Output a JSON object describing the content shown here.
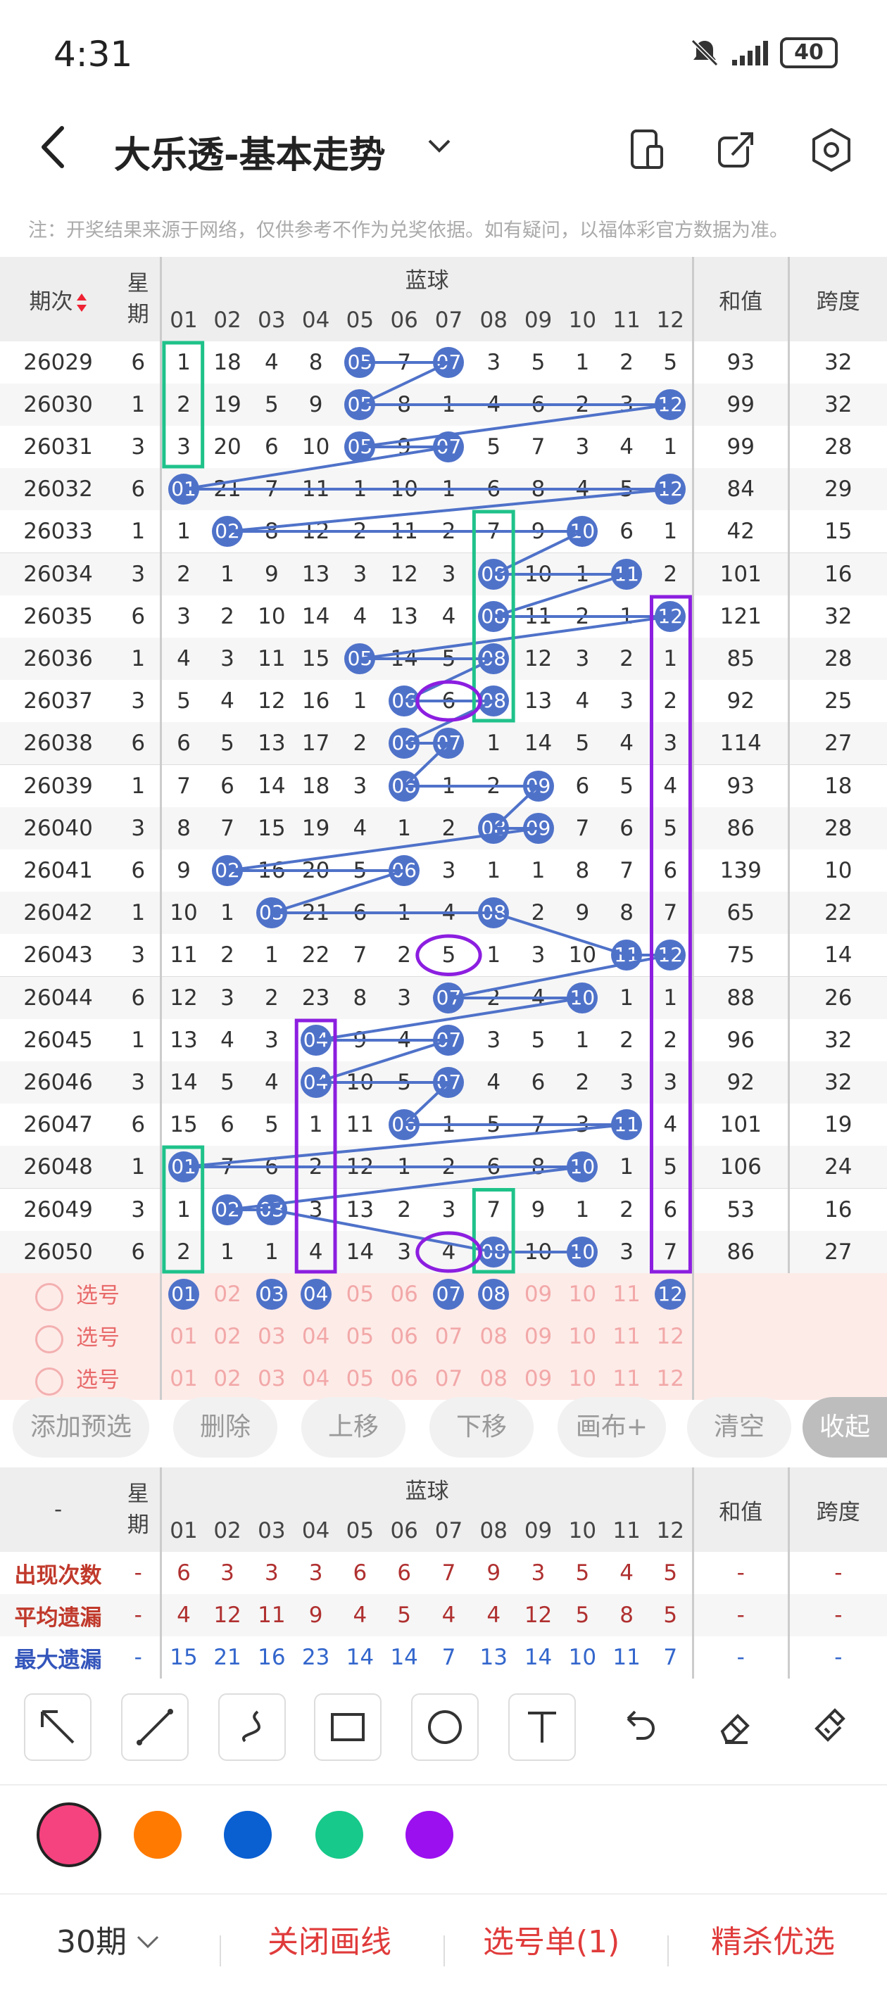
{
  "status": {
    "time": "4:31",
    "battery": "40"
  },
  "header": {
    "title": "大乐透-基本走势"
  },
  "note": "注：开奖结果来源于网络，仅供参考不作为兑奖依据。如有疑问，以福体彩官方数据为准。",
  "table": {
    "col_issue": "期次",
    "col_week": "星期",
    "group_label": "蓝球",
    "nums": [
      "01",
      "02",
      "03",
      "04",
      "05",
      "06",
      "07",
      "08",
      "09",
      "10",
      "11",
      "12"
    ],
    "col_sum": "和值",
    "col_span": "跨度",
    "rows": [
      {
        "issue": "26029",
        "week": "6",
        "cells": [
          "1",
          "18",
          "4",
          "8",
          "05",
          "7",
          "07",
          "3",
          "5",
          "1",
          "2",
          "5"
        ],
        "hit": [
          4,
          6
        ],
        "sum": "93",
        "span": "32"
      },
      {
        "issue": "26030",
        "week": "1",
        "cells": [
          "2",
          "19",
          "5",
          "9",
          "05",
          "8",
          "1",
          "4",
          "6",
          "2",
          "3",
          "12"
        ],
        "hit": [
          4,
          11
        ],
        "sum": "99",
        "span": "32"
      },
      {
        "issue": "26031",
        "week": "3",
        "cells": [
          "3",
          "20",
          "6",
          "10",
          "05",
          "9",
          "07",
          "5",
          "7",
          "3",
          "4",
          "1"
        ],
        "hit": [
          4,
          6
        ],
        "sum": "99",
        "span": "28"
      },
      {
        "issue": "26032",
        "week": "6",
        "cells": [
          "01",
          "21",
          "7",
          "11",
          "1",
          "10",
          "1",
          "6",
          "8",
          "4",
          "5",
          "12"
        ],
        "hit": [
          0,
          11
        ],
        "sum": "84",
        "span": "29"
      },
      {
        "issue": "26033",
        "week": "1",
        "cells": [
          "1",
          "02",
          "8",
          "12",
          "2",
          "11",
          "2",
          "7",
          "9",
          "10",
          "6",
          "1"
        ],
        "hit": [
          1,
          9
        ],
        "sum": "42",
        "span": "15"
      },
      {
        "issue": "26034",
        "week": "3",
        "cells": [
          "2",
          "1",
          "9",
          "13",
          "3",
          "12",
          "3",
          "08",
          "10",
          "1",
          "11",
          "2"
        ],
        "hit": [
          7,
          10
        ],
        "sum": "101",
        "span": "16"
      },
      {
        "issue": "26035",
        "week": "6",
        "cells": [
          "3",
          "2",
          "10",
          "14",
          "4",
          "13",
          "4",
          "08",
          "11",
          "2",
          "1",
          "12"
        ],
        "hit": [
          7,
          11
        ],
        "sum": "121",
        "span": "32"
      },
      {
        "issue": "26036",
        "week": "1",
        "cells": [
          "4",
          "3",
          "11",
          "15",
          "05",
          "14",
          "5",
          "08",
          "12",
          "3",
          "2",
          "1"
        ],
        "hit": [
          4,
          7
        ],
        "sum": "85",
        "span": "28"
      },
      {
        "issue": "26037",
        "week": "3",
        "cells": [
          "5",
          "4",
          "12",
          "16",
          "1",
          "06",
          "6",
          "08",
          "13",
          "4",
          "3",
          "2"
        ],
        "hit": [
          5,
          7
        ],
        "sum": "92",
        "span": "25"
      },
      {
        "issue": "26038",
        "week": "6",
        "cells": [
          "6",
          "5",
          "13",
          "17",
          "2",
          "06",
          "07",
          "1",
          "14",
          "5",
          "4",
          "3"
        ],
        "hit": [
          5,
          6
        ],
        "sum": "114",
        "span": "27"
      },
      {
        "issue": "26039",
        "week": "1",
        "cells": [
          "7",
          "6",
          "14",
          "18",
          "3",
          "06",
          "1",
          "2",
          "09",
          "6",
          "5",
          "4"
        ],
        "hit": [
          5,
          8
        ],
        "sum": "93",
        "span": "18"
      },
      {
        "issue": "26040",
        "week": "3",
        "cells": [
          "8",
          "7",
          "15",
          "19",
          "4",
          "1",
          "2",
          "08",
          "09",
          "7",
          "6",
          "5"
        ],
        "hit": [
          7,
          8
        ],
        "sum": "86",
        "span": "28"
      },
      {
        "issue": "26041",
        "week": "6",
        "cells": [
          "9",
          "02",
          "16",
          "20",
          "5",
          "06",
          "3",
          "1",
          "1",
          "8",
          "7",
          "6"
        ],
        "hit": [
          1,
          5
        ],
        "sum": "139",
        "span": "10"
      },
      {
        "issue": "26042",
        "week": "1",
        "cells": [
          "10",
          "1",
          "03",
          "21",
          "6",
          "1",
          "4",
          "08",
          "2",
          "9",
          "8",
          "7"
        ],
        "hit": [
          2,
          7
        ],
        "sum": "65",
        "span": "22"
      },
      {
        "issue": "26043",
        "week": "3",
        "cells": [
          "11",
          "2",
          "1",
          "22",
          "7",
          "2",
          "5",
          "1",
          "3",
          "10",
          "11",
          "12"
        ],
        "hit": [
          10,
          11
        ],
        "sum": "75",
        "span": "14"
      },
      {
        "issue": "26044",
        "week": "6",
        "cells": [
          "12",
          "3",
          "2",
          "23",
          "8",
          "3",
          "07",
          "2",
          "4",
          "10",
          "1",
          "1"
        ],
        "hit": [
          6,
          9
        ],
        "sum": "88",
        "span": "26"
      },
      {
        "issue": "26045",
        "week": "1",
        "cells": [
          "13",
          "4",
          "3",
          "04",
          "9",
          "4",
          "07",
          "3",
          "5",
          "1",
          "2",
          "2"
        ],
        "hit": [
          3,
          6
        ],
        "sum": "96",
        "span": "32"
      },
      {
        "issue": "26046",
        "week": "3",
        "cells": [
          "14",
          "5",
          "4",
          "04",
          "10",
          "5",
          "07",
          "4",
          "6",
          "2",
          "3",
          "3"
        ],
        "hit": [
          3,
          6
        ],
        "sum": "92",
        "span": "32"
      },
      {
        "issue": "26047",
        "week": "6",
        "cells": [
          "15",
          "6",
          "5",
          "1",
          "11",
          "06",
          "1",
          "5",
          "7",
          "3",
          "11",
          "4"
        ],
        "hit": [
          5,
          10
        ],
        "sum": "101",
        "span": "19"
      },
      {
        "issue": "26048",
        "week": "1",
        "cells": [
          "01",
          "7",
          "6",
          "2",
          "12",
          "1",
          "2",
          "6",
          "8",
          "10",
          "1",
          "5"
        ],
        "hit": [
          0,
          9
        ],
        "sum": "106",
        "span": "24"
      },
      {
        "issue": "26049",
        "week": "3",
        "cells": [
          "1",
          "02",
          "03",
          "3",
          "13",
          "2",
          "3",
          "7",
          "9",
          "1",
          "2",
          "6"
        ],
        "hit": [
          1,
          2
        ],
        "sum": "53",
        "span": "16"
      },
      {
        "issue": "26050",
        "week": "6",
        "cells": [
          "2",
          "1",
          "1",
          "4",
          "14",
          "3",
          "4",
          "08",
          "10",
          "10",
          "3",
          "7"
        ],
        "hit": [
          7,
          9
        ],
        "sum": "86",
        "span": "27"
      }
    ],
    "pick_label": "选号",
    "pick_rows": [
      {
        "sel": [
          0,
          2,
          3,
          6,
          7,
          11
        ]
      },
      {
        "sel": []
      },
      {
        "sel": []
      }
    ]
  },
  "actions": [
    "添加预选",
    "删除",
    "上移",
    "下移",
    "画布+",
    "清空",
    "收起"
  ],
  "stats": {
    "dash": "-",
    "col_week": "星期",
    "group_label": "蓝球",
    "col_sum": "和值",
    "col_span": "跨度",
    "rows": [
      {
        "label": "出现次数",
        "week": "-",
        "values": [
          "6",
          "3",
          "3",
          "3",
          "6",
          "6",
          "7",
          "9",
          "3",
          "5",
          "4",
          "5"
        ],
        "sum": "-",
        "span": "-"
      },
      {
        "label": "平均遗漏",
        "week": "-",
        "values": [
          "4",
          "12",
          "11",
          "9",
          "4",
          "5",
          "4",
          "4",
          "12",
          "5",
          "8",
          "5"
        ],
        "sum": "-",
        "span": "-"
      },
      {
        "label": "最大遗漏",
        "week": "-",
        "values": [
          "15",
          "21",
          "16",
          "23",
          "14",
          "14",
          "7",
          "13",
          "14",
          "10",
          "11",
          "7"
        ],
        "sum": "-",
        "span": "-"
      }
    ]
  },
  "palette": [
    "#f5437f",
    "#ff7a00",
    "#0a5fd1",
    "#17c98a",
    "#9b10ef"
  ],
  "bottom": {
    "period": "30期",
    "close_draw": "关闭画线",
    "pick_list": "选号单(1)",
    "kill": "精杀优选"
  }
}
